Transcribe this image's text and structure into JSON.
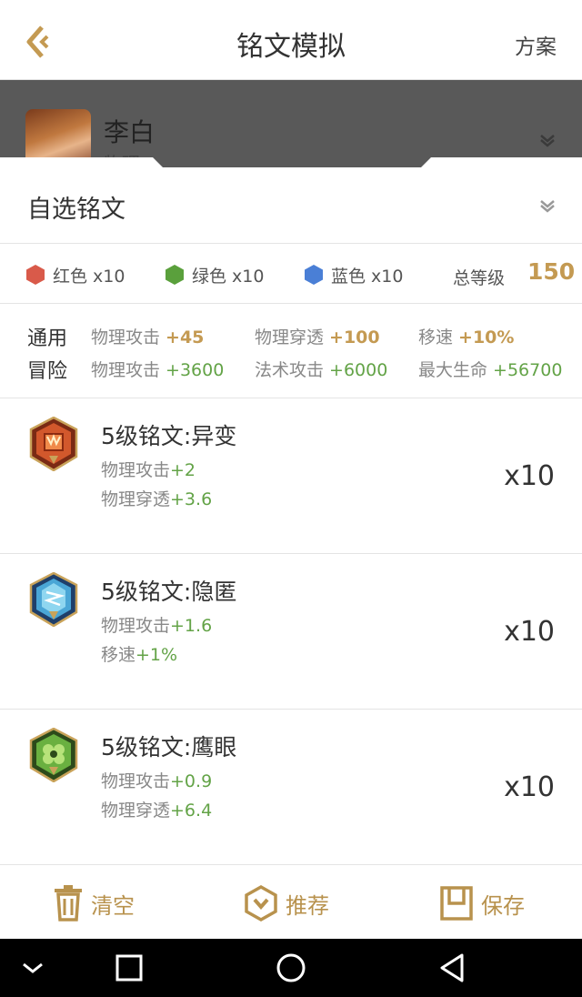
{
  "header": {
    "title": "铭文模拟",
    "plan_label": "方案"
  },
  "hero": {
    "name": "李白",
    "type": "物理"
  },
  "selector": {
    "label": "自选铭文"
  },
  "colors": [
    {
      "name": "红色 x10",
      "color": "#d95a4a"
    },
    {
      "name": "绿色 x10",
      "color": "#5aa03c"
    },
    {
      "name": "蓝色 x10",
      "color": "#4a7fd6"
    }
  ],
  "total": {
    "label": "总等级",
    "value": "150"
  },
  "stats": {
    "general_label": "通用",
    "adventure_label": "冒险",
    "general": [
      {
        "name": "物理攻击 ",
        "value": "+45"
      },
      {
        "name": "物理穿透 ",
        "value": "+100"
      },
      {
        "name": "移速 ",
        "value": "+10%"
      }
    ],
    "adventure": [
      {
        "name": "物理攻击 ",
        "value": "+3600"
      },
      {
        "name": "法术攻击 ",
        "value": "+6000"
      },
      {
        "name": "最大生命 ",
        "value": "+56700"
      }
    ]
  },
  "runes": [
    {
      "title": "5级铭文:异变",
      "count": "x10",
      "icon": "red-rune-icon",
      "attrs": [
        {
          "name": "物理攻击",
          "value": "+2"
        },
        {
          "name": "物理穿透",
          "value": "+3.6"
        }
      ]
    },
    {
      "title": "5级铭文:隐匿",
      "count": "x10",
      "icon": "blue-rune-icon",
      "attrs": [
        {
          "name": "物理攻击",
          "value": "+1.6"
        },
        {
          "name": "移速",
          "value": "+1%"
        }
      ]
    },
    {
      "title": "5级铭文:鹰眼",
      "count": "x10",
      "icon": "green-rune-icon",
      "attrs": [
        {
          "name": "物理攻击",
          "value": "+0.9"
        },
        {
          "name": "物理穿透",
          "value": "+6.4"
        }
      ]
    }
  ],
  "bottom": {
    "clear_label": "清空",
    "recommend_label": "推荐",
    "save_label": "保存"
  },
  "accent": "#b8924d"
}
